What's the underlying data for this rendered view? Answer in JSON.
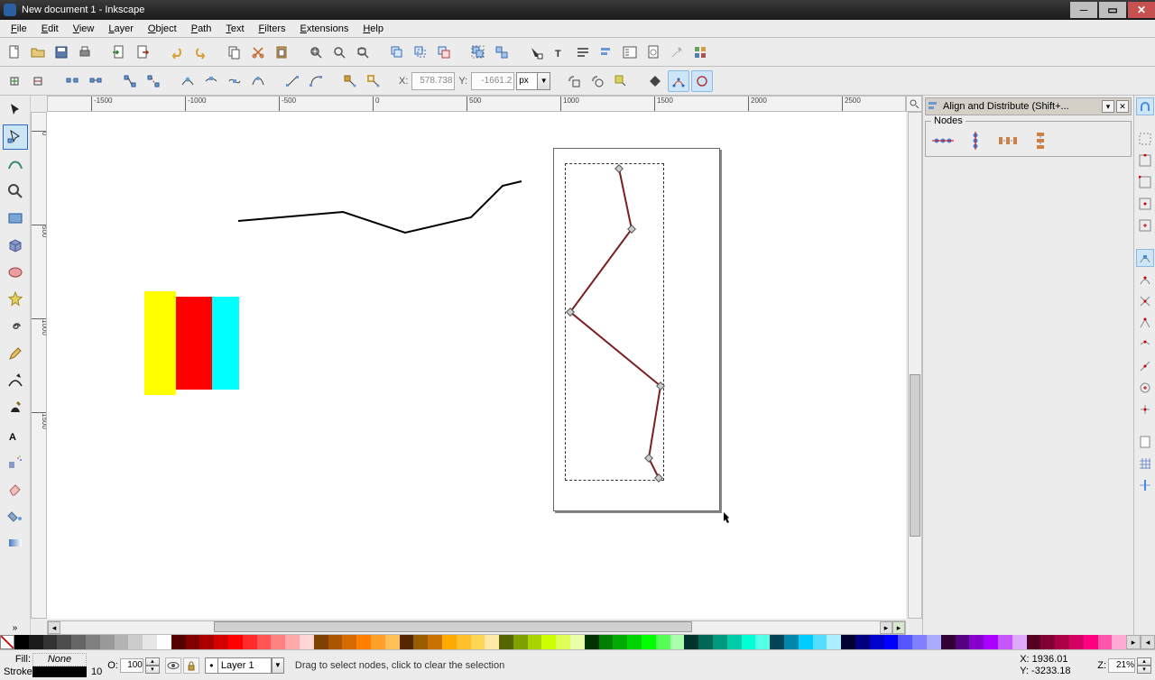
{
  "window": {
    "title": "New document 1 - Inkscape"
  },
  "menus": [
    "File",
    "Edit",
    "View",
    "Layer",
    "Object",
    "Path",
    "Text",
    "Filters",
    "Extensions",
    "Help"
  ],
  "coord": {
    "x_label": "X:",
    "x": "578.738",
    "y_label": "Y:",
    "y": "-1661.2",
    "unit": "px"
  },
  "zoom": {
    "label": "Z:",
    "value": "21%"
  },
  "status": {
    "fill_label": "Fill:",
    "fill_value": "None",
    "stroke_label": "Stroke:",
    "stroke_width": "10",
    "opacity_label": "O:",
    "opacity_value": "100",
    "layer": "Layer 1",
    "msg": "Drag to select nodes, click to clear the selection",
    "pointer_x": "X: 1936.01",
    "pointer_y": "Y: -3233.18"
  },
  "panel": {
    "title": "Align and Distribute (Shift+...",
    "group": "Nodes"
  },
  "ruler_h": [
    "-1500",
    "-1000",
    "-500",
    "0",
    "500",
    "1000",
    "1500",
    "2000",
    "2500"
  ],
  "ruler_v": [
    "0",
    "500",
    "1000",
    "1500"
  ],
  "palette": [
    "#000000",
    "#1a1a1a",
    "#333333",
    "#4d4d4d",
    "#666666",
    "#808080",
    "#999999",
    "#b3b3b3",
    "#cccccc",
    "#e6e6e6",
    "#ffffff",
    "#550000",
    "#800000",
    "#aa0000",
    "#d40000",
    "#ff0000",
    "#ff2a2a",
    "#ff5555",
    "#ff8080",
    "#ffaaaa",
    "#ffd5d5",
    "#804000",
    "#aa5500",
    "#d46a00",
    "#ff8000",
    "#ffa02a",
    "#ffc055",
    "#552700",
    "#995c00",
    "#c87100",
    "#ffaa00",
    "#ffc02a",
    "#ffd555",
    "#ffeaaa",
    "#556600",
    "#80a000",
    "#aad400",
    "#ccff00",
    "#dfff55",
    "#eaffaa",
    "#003300",
    "#008000",
    "#00aa00",
    "#00d400",
    "#00ff00",
    "#55ff55",
    "#aaffaa",
    "#00332b",
    "#006655",
    "#009980",
    "#00ccaa",
    "#00ffd5",
    "#55ffea",
    "#004455",
    "#0088aa",
    "#00ccff",
    "#55ddff",
    "#aaeeff",
    "#000033",
    "#000080",
    "#0000cc",
    "#0000ff",
    "#5555ff",
    "#8080ff",
    "#aaaaff",
    "#330033",
    "#550080",
    "#8800cc",
    "#aa00ff",
    "#c655ff",
    "#ddaaff",
    "#550022",
    "#800033",
    "#aa0044",
    "#d40066",
    "#ff0080",
    "#ff55aa",
    "#ffaad5"
  ]
}
